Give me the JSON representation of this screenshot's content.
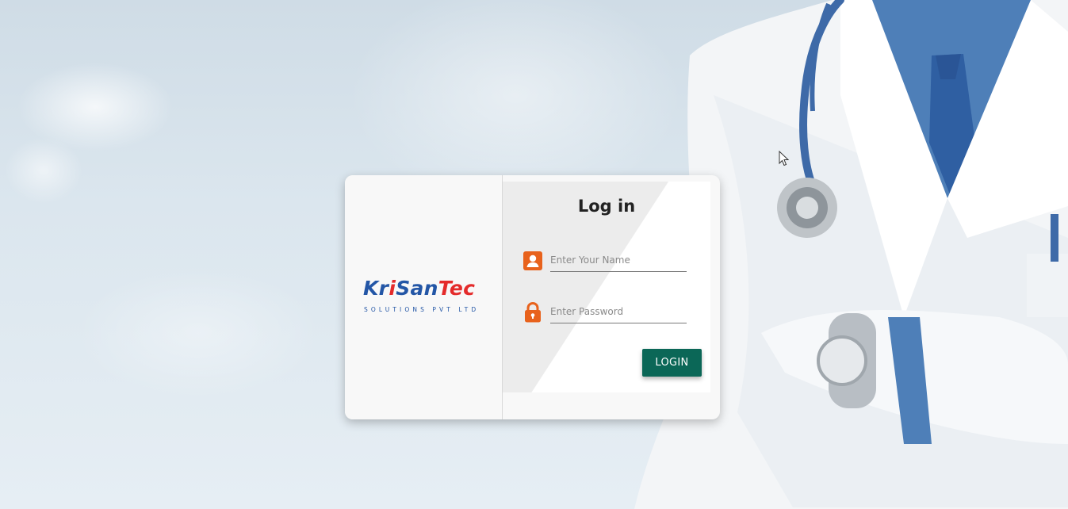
{
  "logo": {
    "part1": "Kr",
    "part2": "i",
    "part3": "San",
    "part4": "Tec",
    "subtitle": "SOLUTIONS PVT LTD",
    "colors": {
      "blue": "#2356a6",
      "red": "#e42b2b"
    }
  },
  "login": {
    "title": "Log in",
    "username_placeholder": "Enter Your Name",
    "username_value": "",
    "password_placeholder": "Enter Password",
    "password_value": "",
    "username_icon": "user-icon",
    "password_icon": "lock-icon",
    "button_label": "LOGIN",
    "button_color": "#0b6757",
    "icon_color": "#e8621c"
  }
}
